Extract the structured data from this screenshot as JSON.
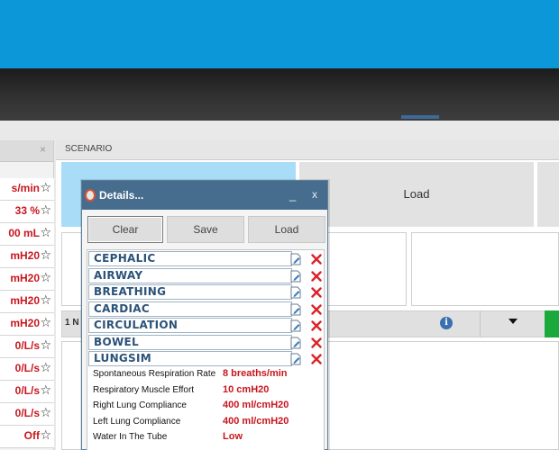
{
  "left_panel": {
    "close": "×",
    "rows": [
      {
        "value": "s/min"
      },
      {
        "value": "33 %"
      },
      {
        "value": "00 mL"
      },
      {
        "value": "mH20"
      },
      {
        "value": "mH20"
      },
      {
        "value": "mH20"
      },
      {
        "value": "mH20"
      },
      {
        "value": "0/L/s"
      },
      {
        "value": "0/L/s"
      },
      {
        "value": "0/L/s"
      },
      {
        "value": "0/L/s"
      },
      {
        "value": "Off"
      }
    ],
    "star": "☆"
  },
  "scenario": {
    "title": "SCENARIO",
    "load_tile": "Load",
    "toolbar_text": "1 N",
    "info_icon": "i"
  },
  "dialog": {
    "title": "Details...",
    "minimize": "_",
    "close": "x",
    "buttons": {
      "clear": "Clear",
      "save": "Save",
      "load": "Load"
    },
    "sections": [
      "CEPHALIC",
      "AIRWAY",
      "BREATHING",
      "CARDIAC",
      "CIRCULATION",
      "BOWEL",
      "LUNGSIM"
    ],
    "properties": [
      {
        "name": "Spontaneous Respiration Rate",
        "value": "8 breaths/min"
      },
      {
        "name": "Respiratory Muscle Effort",
        "value": "10 cmH20"
      },
      {
        "name": "Right Lung Compliance",
        "value": "400 ml/cmH20"
      },
      {
        "name": "Left Lung Compliance",
        "value": "400 ml/cmH20"
      },
      {
        "name": "Water In The Tube",
        "value": "Low"
      }
    ]
  },
  "colors": {
    "top_blue": "#0c97d8",
    "dialog_title": "#466d8d",
    "section_text": "#2b5278",
    "value_red": "#c8161d",
    "delete_red": "#d9232a"
  },
  "icons": [
    "edit-icon",
    "delete-icon",
    "info-icon",
    "caret-down-icon",
    "star-icon",
    "app-logo-icon"
  ]
}
